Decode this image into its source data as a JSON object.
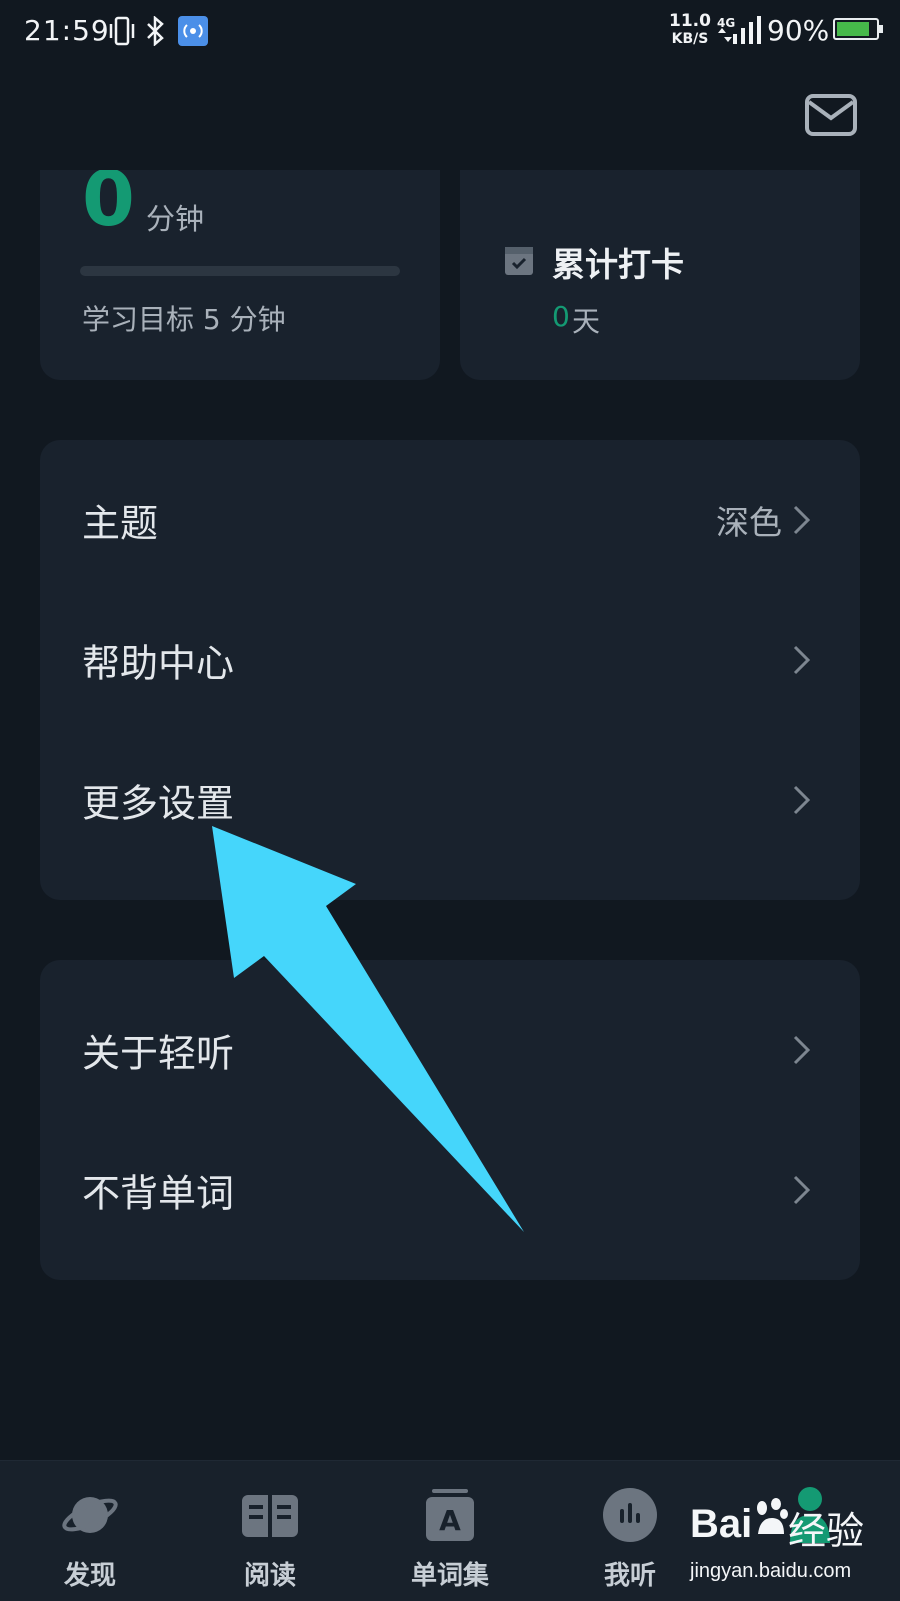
{
  "status_bar": {
    "time": "21:59",
    "net_speed_value": "11.0",
    "net_speed_unit": "KB/S",
    "network_type": "4G",
    "battery_percent": "90%",
    "battery_level": 0.9,
    "icons": [
      "vibrate-icon",
      "bluetooth-icon",
      "hotspot-icon",
      "signal-icon",
      "battery-icon"
    ]
  },
  "header": {
    "mail_icon": "mail-icon"
  },
  "stats": {
    "study_minutes": "0",
    "minutes_unit": "分钟",
    "goal_text": "学习目标 5 分钟",
    "goal_progress": 0,
    "checkin_title": "累计打卡",
    "checkin_days": "0",
    "checkin_unit": "天"
  },
  "menu_group1": [
    {
      "label": "主题",
      "value": "深色"
    },
    {
      "label": "帮助中心",
      "value": ""
    },
    {
      "label": "更多设置",
      "value": ""
    }
  ],
  "menu_group2": [
    {
      "label": "关于轻听"
    },
    {
      "label": "不背单词"
    }
  ],
  "bottom_nav": [
    {
      "label": "发现",
      "icon": "planet-icon"
    },
    {
      "label": "阅读",
      "icon": "book-icon"
    },
    {
      "label": "单词集",
      "icon": "word-set-icon"
    },
    {
      "label": "我听",
      "icon": "listen-icon"
    },
    {
      "label": "",
      "icon": "account-icon"
    }
  ],
  "watermark": {
    "brand": "Bai",
    "brand2": "经验",
    "url": "jingyan.baidu.com"
  },
  "colors": {
    "accent": "#149a73",
    "background": "#111820",
    "card": "#19222d",
    "annotation_arrow": "#45d6fb"
  }
}
